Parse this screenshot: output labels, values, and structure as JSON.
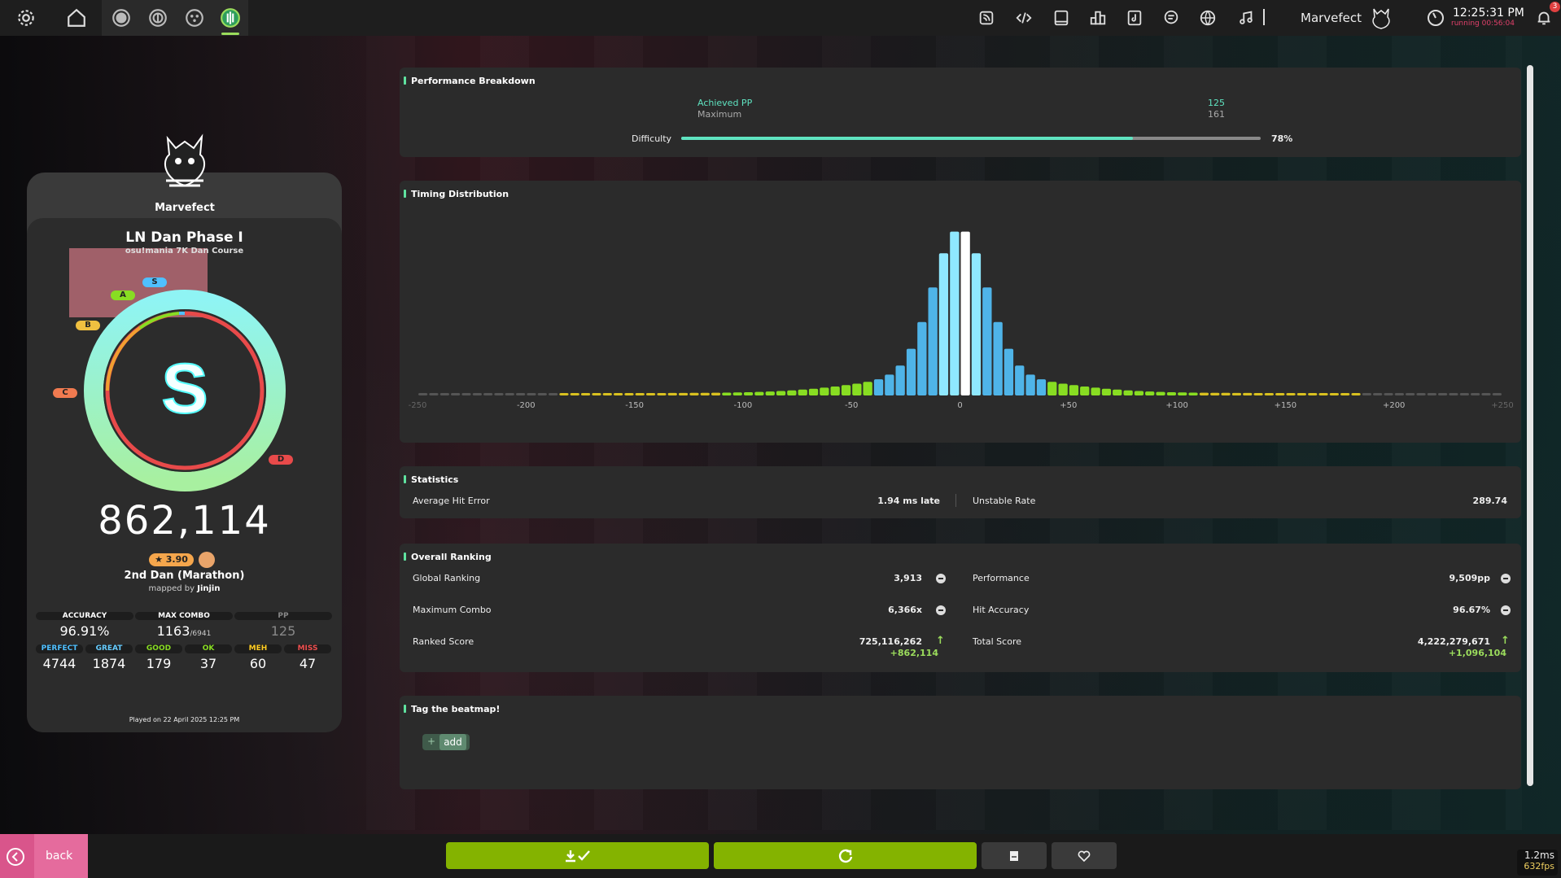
{
  "topbar": {
    "username": "Marvefect",
    "time": "12:25:31 PM",
    "running": "running 00:56:04",
    "notification_count": "3",
    "icons_left": [
      "gear-icon",
      "home-icon",
      "ruleset-osu-icon",
      "ruleset-taiko-icon",
      "ruleset-catch-icon",
      "ruleset-mania-icon"
    ],
    "icons_right": [
      "news-icon",
      "devtools-icon",
      "tablet-icon",
      "rankings-icon",
      "beatmap-listing-icon",
      "chat-icon",
      "dashboard-icon",
      "now-playing-icon"
    ]
  },
  "player": {
    "name": "Marvefect"
  },
  "beatmap": {
    "title": "LN Dan Phase I",
    "artist": "osu!mania 7K Dan Course",
    "difficulty": "2nd Dan (Marathon)",
    "mapped_by_prefix": "mapped by",
    "mapper": "Jinjin",
    "star_rating": "★ 3.90"
  },
  "score": {
    "total": "862,114",
    "grade": "S",
    "grade_pills": [
      "A",
      "S",
      "B",
      "C",
      "D"
    ],
    "accuracy_label": "ACCURACY",
    "accuracy": "96.91%",
    "accuracy_fraction": 0.9691,
    "max_combo_label": "MAX COMBO",
    "max_combo": "1163",
    "max_combo_total": "/6941",
    "pp_label": "PP",
    "pp": "125",
    "played_on": "Played on 22 April 2025 12:25 PM"
  },
  "judgements": [
    {
      "label": "PERFECT",
      "value": "4744",
      "color": "#4fc0ff"
    },
    {
      "label": "GREAT",
      "value": "1874",
      "color": "#66ccff"
    },
    {
      "label": "GOOD",
      "value": "179",
      "color": "#88dd22"
    },
    {
      "label": "OK",
      "value": "37",
      "color": "#88dd22"
    },
    {
      "label": "MEH",
      "value": "60",
      "color": "#ffcc22"
    },
    {
      "label": "MISS",
      "value": "47",
      "color": "#ed4f4f"
    }
  ],
  "performance": {
    "title": "Performance Breakdown",
    "achieved_label": "Achieved PP",
    "achieved_value": "125",
    "maximum_label": "Maximum",
    "maximum_value": "161",
    "difficulty_label": "Difficulty",
    "difficulty_percent": "78%",
    "difficulty_fraction": 0.78
  },
  "timing": {
    "title": "Timing Distribution",
    "axis_labels": [
      "-250",
      "-200",
      "-150",
      "-100",
      "-50",
      "0",
      "+50",
      "+100",
      "+150",
      "+200",
      "+250"
    ]
  },
  "statistics": {
    "title": "Statistics",
    "avg_hit_error_label": "Average Hit Error",
    "avg_hit_error_value": "1.94 ms late",
    "unstable_rate_label": "Unstable Rate",
    "unstable_rate_value": "289.74"
  },
  "ranking": {
    "title": "Overall Ranking",
    "global_ranking_label": "Global Ranking",
    "global_ranking_value": "3,913",
    "performance_label": "Performance",
    "performance_value": "9,509pp",
    "max_combo_label": "Maximum Combo",
    "max_combo_value": "6,366x",
    "hit_accuracy_label": "Hit Accuracy",
    "hit_accuracy_value": "96.67%",
    "ranked_score_label": "Ranked Score",
    "ranked_score_value": "725,116,262",
    "ranked_score_delta": "+862,114",
    "total_score_label": "Total Score",
    "total_score_value": "4,222,279,671",
    "total_score_delta": "+1,096,104"
  },
  "tags": {
    "title": "Tag the beatmap!",
    "add_label": "add"
  },
  "bottom": {
    "back_label": "back",
    "fps_ms": "1.2ms",
    "fps": "632fps"
  },
  "colors": {
    "accent_green": "#84b300",
    "perf_bar": "#5fe3c0",
    "ring_outer": "#8ef0f0",
    "ring_inner": "#e84a4a"
  }
}
